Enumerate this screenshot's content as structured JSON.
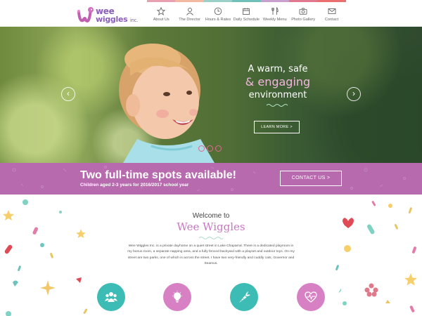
{
  "brand": {
    "line1": "wee",
    "line2": "wiggles",
    "suffix": "inc."
  },
  "nav": [
    {
      "label": "About Us",
      "icon": "star-icon",
      "color": "#e8a0b0"
    },
    {
      "label": "The Director",
      "icon": "person-icon",
      "color": "#f2b8a0"
    },
    {
      "label": "Hours & Rates",
      "icon": "clock-icon",
      "color": "#9ad0c8"
    },
    {
      "label": "Daily Schedule",
      "icon": "calendar-icon",
      "color": "#6fc0b8"
    },
    {
      "label": "Weekly Menu",
      "icon": "utensils-icon",
      "color": "#c8a0d0"
    },
    {
      "label": "Photo Gallery",
      "icon": "camera-icon",
      "color": "#e07890"
    },
    {
      "label": "Contact",
      "icon": "envelope-icon",
      "color": "#ea7070"
    }
  ],
  "hero": {
    "line1": "A warm, safe",
    "line2": "& engaging",
    "line3": "environment",
    "cta": "LEARN MORE >",
    "prev": "‹",
    "next": "›"
  },
  "banner": {
    "title": "Two full-time spots available!",
    "subtitle": "Children aged 2-3 years for 2016/2017 school year",
    "cta": "CONTACT US >"
  },
  "welcome": {
    "intro": "Welcome to",
    "name": "Wee Wiggles",
    "body": "Wee Wiggles Inc. is a private dayhome on a quiet street in Lake Chaparral. There is a dedicated playroom in my bonus room, a separate napping area, and a fully fenced backyard with a playset and outdoor toys. On my street are two parks, one of which is across the street. I have two very-friendly and cuddly cats, Governor and Seamus."
  },
  "features": [
    {
      "icon": "group-icon",
      "color": "#3cbcb4"
    },
    {
      "icon": "lightbulb-icon",
      "color": "#d880c4"
    },
    {
      "icon": "carrot-icon",
      "color": "#3cbcb4"
    },
    {
      "icon": "heart-pulse-icon",
      "color": "#d880c4"
    }
  ]
}
